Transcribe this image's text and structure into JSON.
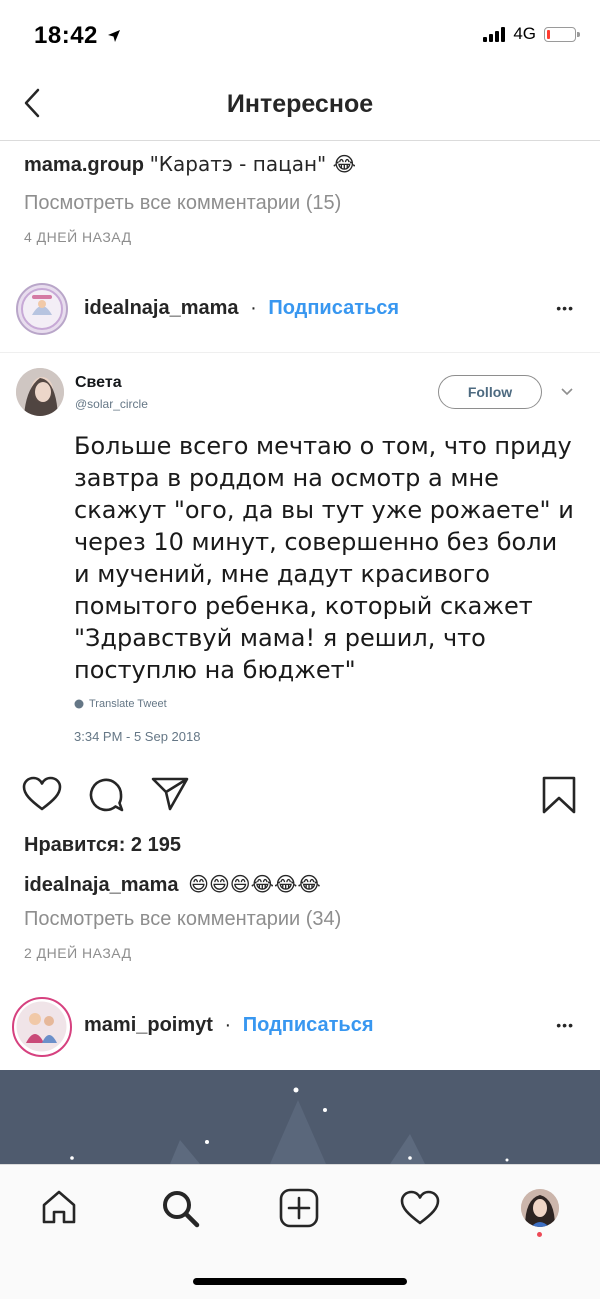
{
  "status_bar": {
    "time": "18:42",
    "network": "4G"
  },
  "nav": {
    "title": "Интересное"
  },
  "prev_post": {
    "caption_user": "mama.group",
    "caption_text": "\"Каратэ - пацан\" 😂",
    "view_comments": "Посмотреть все комментарии (15)",
    "time_ago": "4 ДНЕЙ НАЗАД"
  },
  "post": {
    "username": "idealnaja_mama",
    "separator": "·",
    "follow_label": "Подписаться",
    "more": "•••",
    "tweet": {
      "name": "Света",
      "handle": "@solar_circle",
      "follow_label": "Follow",
      "text": "Больше всего мечтаю о том, что приду завтра в роддом на осмотр а мне скажут \"ого, да вы тут уже рожаете\" и через 10 минут, совершенно без боли и мучений, мне дадут красивого помытого ребенка, который скажет \"Здравствуй мама! я решил, что поступлю на бюджет\"",
      "translate": "Translate Tweet",
      "timestamp": "3:34 PM - 5 Sep 2018"
    },
    "likes": "Нравится: 2 195",
    "caption_user": "idealnaja_mama",
    "caption_text": "😄😄😄😂😂😂",
    "view_comments": "Посмотреть все комментарии (34)",
    "time_ago": "2 ДНЕЙ НАЗАД"
  },
  "next_post": {
    "username": "mami_poimyt",
    "separator": "·",
    "follow_label": "Подписаться",
    "more": "•••"
  },
  "colors": {
    "link": "#3897f0",
    "muted": "#8e8e8e",
    "image_bg": "#4f5b6e"
  },
  "tab_bar": [
    "home-icon",
    "search-icon",
    "add-icon",
    "heart-icon",
    "profile-avatar"
  ]
}
